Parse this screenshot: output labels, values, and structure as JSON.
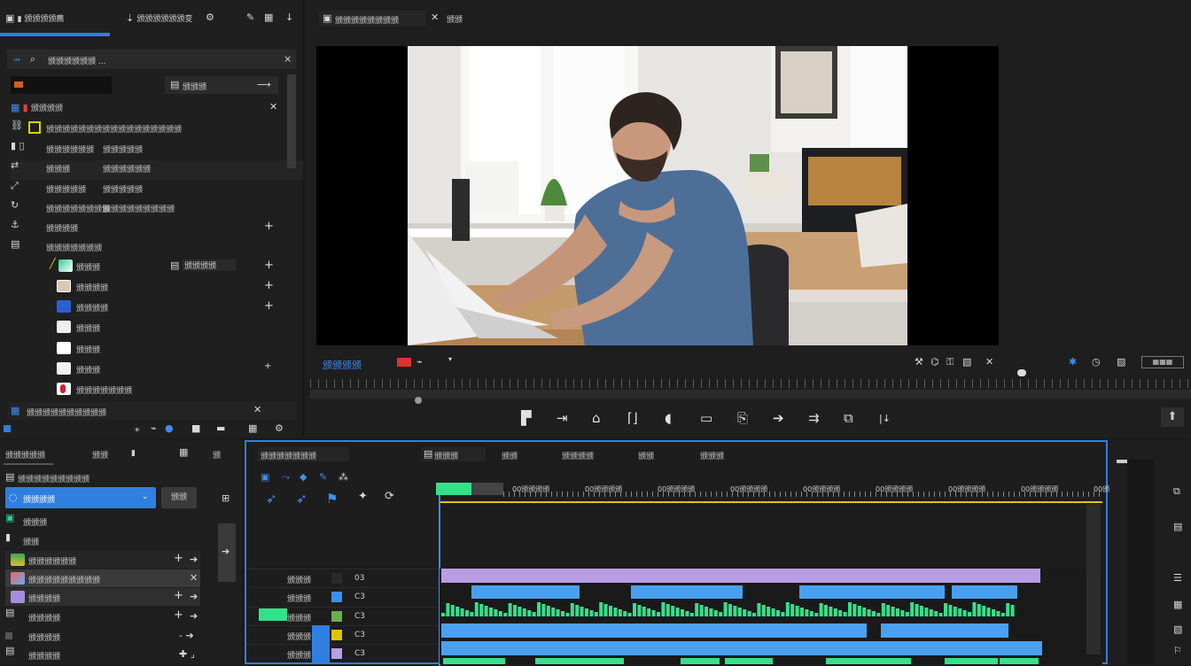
{
  "left_panel": {
    "tab1": "▮ 颁颁颁颁薦",
    "tab2": "颁颁颁颁颁颁变",
    "search_title": "颁颁颁颁颁颁 ...",
    "dropdown_label": "颁颁颁",
    "section_title": "颁颁颁颁",
    "rows": [
      {
        "a": "颁颁颁颁颁颁颁颁颁颁颁颁颁颁颁颁颁",
        "b": ""
      },
      {
        "a": "颁颁颁颁颁颁",
        "b": "颁颁颁颁颁"
      },
      {
        "a": "颁颁颁",
        "b": "颁颁颁颁颁颁"
      },
      {
        "a": "颁颁颁颁颁",
        "b": "颁颁颁颁颁"
      },
      {
        "a": "颁颁颁颁颁颁颁颁",
        "b": "颁颁颁颁颁颁颁颁颁"
      },
      {
        "a": "颁颁颁颁",
        "b": "颁颁颁颁"
      }
    ],
    "group_label": "颁颁颁颁颁颁颁",
    "items": [
      {
        "label": "颁颁颁",
        "extra": "颁颁颁颁"
      },
      {
        "label": "颁颁颁颁",
        "extra": ""
      },
      {
        "label": "颁颁颁颁",
        "extra": ""
      },
      {
        "label": "颁颁颁",
        "extra": ""
      },
      {
        "label": "颁颁颁",
        "extra": ""
      },
      {
        "label": "颁颁颁",
        "extra": ""
      },
      {
        "label": "颁颁颁颁颁颁颁",
        "extra": ""
      }
    ],
    "footer_label": "颁颁颁颁颁颁颁颁颁颁"
  },
  "viewer": {
    "tab_title": "颁颁颁颁颁颁颁颁",
    "tab2": "颁颁",
    "timecode": "颁颁颁颁"
  },
  "bottom_left": {
    "tabs": [
      "颁颁颁颁颁",
      "颁颁",
      "▮",
      "颁"
    ],
    "subtitle": "颁颁颁颁颁颁颁颁颁",
    "selected": "颁颁颁颁",
    "button": "颁颁",
    "list": [
      "颁颁颁",
      "颁颁",
      "颁颁颁颁颁颁",
      "颁颁颁颁颁颁颁颁颁",
      "颁颁颁颁",
      "颁颁颁颁",
      "颁颁颁颁",
      "颁颁颁颁"
    ]
  },
  "timeline": {
    "title": "颁颁颁颁颁颁颁",
    "tabs": [
      "颁颁颁",
      "颁颁",
      "颁颁颁颁",
      "颁颁",
      "颁颁颁"
    ],
    "ruler_labels": [
      "00颁颁颁颁",
      "00颁颁颁颁",
      "00颁颁颁颁",
      "00颁颁颁颁",
      "00颁颁颁颁",
      "00颁颁颁颁",
      "00颁颁颁颁",
      "00颁颁颁颁",
      "00颁颁颁颁"
    ],
    "track_labels": [
      "颁颁颁",
      "颁颁颁",
      "颁颁颁",
      "颁颁颁",
      "颁颁颁"
    ],
    "track_codes": [
      "03",
      "C3",
      "C3",
      "C3",
      "C3"
    ]
  },
  "colors": {
    "accent": "#2f7fe0",
    "video_clip": "#b79de4",
    "audio_clip": "#4aa0f0",
    "green_clip": "#35e08a",
    "playhead": "#e0c400"
  }
}
